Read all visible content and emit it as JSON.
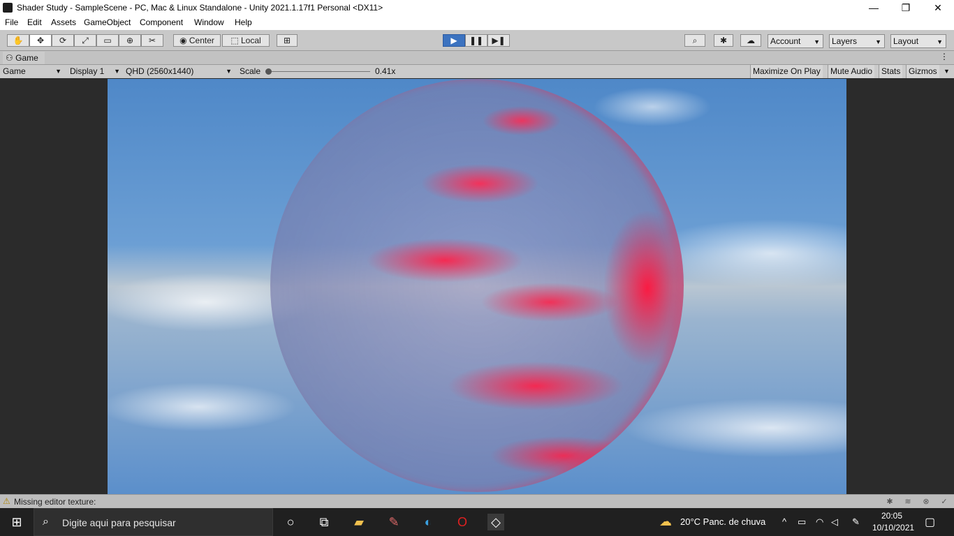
{
  "window": {
    "title": "Shader Study - SampleScene - PC, Mac & Linux Standalone - Unity 2021.1.17f1 Personal <DX11>",
    "controls": {
      "minimize": "—",
      "maximize": "❐",
      "close": "✕"
    }
  },
  "menu": [
    "File",
    "Edit",
    "Assets",
    "GameObject",
    "Component",
    "Window",
    "Help"
  ],
  "toolbar": {
    "tools": [
      {
        "name": "hand-tool",
        "glyph": "✋"
      },
      {
        "name": "move-tool",
        "glyph": "✥"
      },
      {
        "name": "rotate-tool",
        "glyph": "⟳"
      },
      {
        "name": "scale-tool",
        "glyph": "⤢"
      },
      {
        "name": "rect-tool",
        "glyph": "▭"
      },
      {
        "name": "transform-tool",
        "glyph": "⊕"
      },
      {
        "name": "custom-tool",
        "glyph": "✂"
      }
    ],
    "pivot_label": "Center",
    "space_label": "Local",
    "play": "▶",
    "pause": "❚❚",
    "step": "▶❚",
    "account_label": "Account",
    "layers_label": "Layers",
    "layout_label": "Layout"
  },
  "game_tab": {
    "label": "Game"
  },
  "game_bar": {
    "view": "Game",
    "display": "Display 1",
    "resolution": "QHD (2560x1440)",
    "scale_label": "Scale",
    "scale_value": "0.41x",
    "maximize": "Maximize On Play",
    "mute": "Mute Audio",
    "stats": "Stats",
    "gizmos": "Gizmos"
  },
  "status": {
    "message": "Missing editor texture:"
  },
  "taskbar": {
    "search_placeholder": "Digite aqui para pesquisar",
    "weather": "20°C  Panc. de chuva",
    "time": "20:05",
    "date": "10/10/2021"
  },
  "colors": {
    "play_active": "#3c73c0",
    "sphere_red": "#ff2050",
    "sky_blue": "#4f88c8"
  }
}
